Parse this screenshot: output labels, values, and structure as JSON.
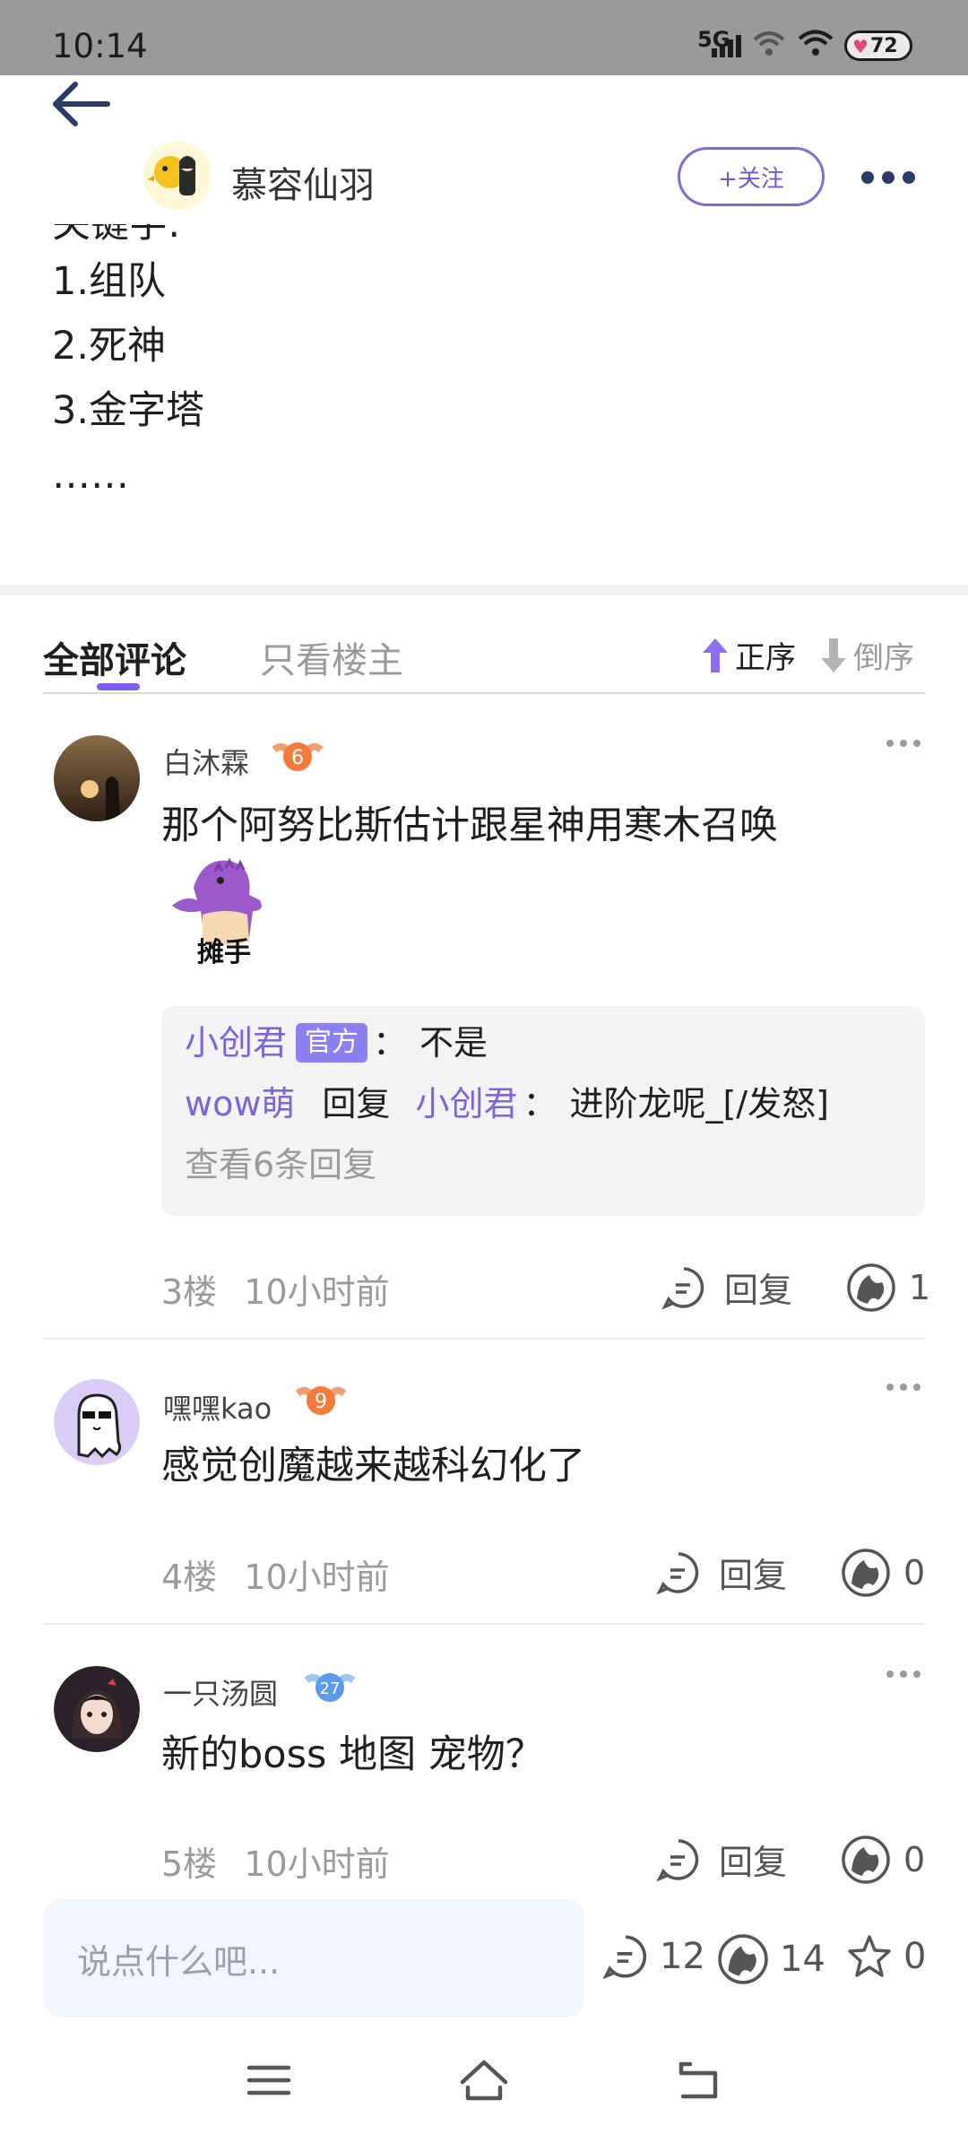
{
  "status_bar": {
    "time": "10:14",
    "signal": "5G",
    "battery": "72"
  },
  "header": {
    "author": "慕容仙羽",
    "follow_label": "+关注"
  },
  "post": {
    "cut_line": "关键字:",
    "lines": [
      "1.组队",
      "2.死神",
      "3.金字塔",
      "……"
    ]
  },
  "tabs": {
    "all": "全部评论",
    "owner_only": "只看楼主",
    "asc": "正序",
    "desc": "倒序"
  },
  "comments": [
    {
      "user": "白沐霖",
      "level": "6",
      "text": "那个阿努比斯估计跟星神用寒木召唤",
      "sticker_caption": "摊手",
      "replies": {
        "r1_user": "小创君",
        "r1_tag": "官方",
        "r1_sep": "：",
        "r1_text": "不是",
        "r2_user": "wow萌",
        "r2_verb": "回复",
        "r2_target": "小创君",
        "r2_sep": "：",
        "r2_text": "进阶龙呢_[/发怒]",
        "view_more": "查看6条回复"
      },
      "floor": "3楼",
      "time": "10小时前",
      "reply_label": "回复",
      "likes": "1"
    },
    {
      "user": "嘿嘿kao",
      "level": "9",
      "text": "感觉创魔越来越科幻化了",
      "floor": "4楼",
      "time": "10小时前",
      "reply_label": "回复",
      "likes": "0"
    },
    {
      "user": "一只汤圆",
      "level": "27",
      "text": "新的boss 地图 宠物？",
      "floor": "5楼",
      "time": "10小时前",
      "reply_label": "回复",
      "likes": "0"
    }
  ],
  "bottom_bar": {
    "placeholder": "说点什么吧...",
    "comments": "12",
    "likes": "14",
    "favorites": "0"
  },
  "colors": {
    "accent": "#7a5ff0",
    "link": "#7a66d6",
    "official_tag": "#8d7ef2"
  }
}
